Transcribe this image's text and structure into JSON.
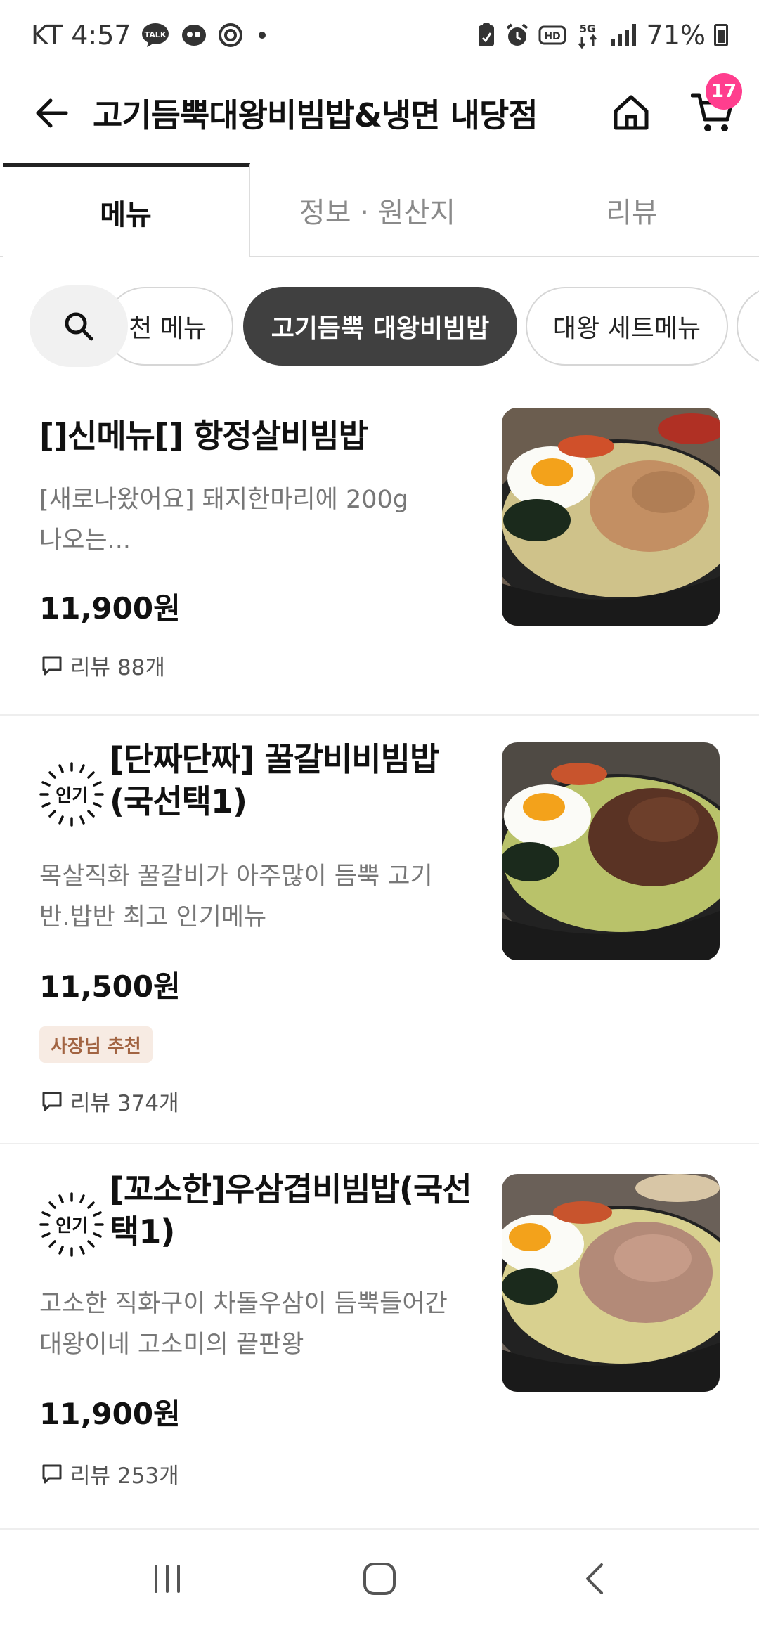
{
  "status_bar": {
    "carrier_time": "KT 4:57",
    "battery_percent": "71%",
    "icons": [
      "talk-icon",
      "messenger-icon",
      "sync-icon",
      "dot-icon",
      "clipboard-icon",
      "alarm-icon",
      "hd-icon",
      "5g-icon",
      "signal-icon",
      "battery-icon"
    ],
    "talk_text": "TALK",
    "hd_text": "HD",
    "network_text": "5G"
  },
  "header": {
    "title": "고기듬뿍대왕비빔밥&냉면 내당점",
    "cart_count": "17"
  },
  "tabs": [
    {
      "label": "메뉴",
      "active": true
    },
    {
      "label": "정보 · 원산지",
      "active": false
    },
    {
      "label": "리뷰",
      "active": false
    }
  ],
  "chips": [
    {
      "label": "천 메뉴",
      "active": false
    },
    {
      "label": "고기듬뿍 대왕비빔밥",
      "active": true
    },
    {
      "label": "대왕 세트메뉴",
      "active": false
    }
  ],
  "menu_items": [
    {
      "name": "[]신메뉴[] 항정살비빔밥",
      "description": "[새로나왔어요] 돼지한마리에 200g 나오는...",
      "price": "11,900원",
      "reviews": "리뷰 88개",
      "popular": false
    },
    {
      "name": "[단짜단짜] 꿀갈비비빔밥(국선택1)",
      "badge": "인기",
      "description": "목살직화 꿀갈비가 아주많이 듬뿍 고기반.밥반 최고 인기메뉴",
      "price": "11,500원",
      "owner_badge": "사장님 추천",
      "reviews": "리뷰 374개",
      "popular": true
    },
    {
      "name": "[꼬소한]우삼겹비빔밥(국선택1)",
      "badge": "인기",
      "description": "고소한 직화구이 차돌우삼이 듬뿍들어간 대왕이네 고소미의 끝판왕",
      "price": "11,900원",
      "reviews": "리뷰 253개",
      "popular": true
    }
  ],
  "colors": {
    "accent_badge": "#ff3e8e",
    "active_chip": "#404040",
    "owner_badge_bg": "#f7ebe3",
    "owner_badge_text": "#a26442"
  }
}
